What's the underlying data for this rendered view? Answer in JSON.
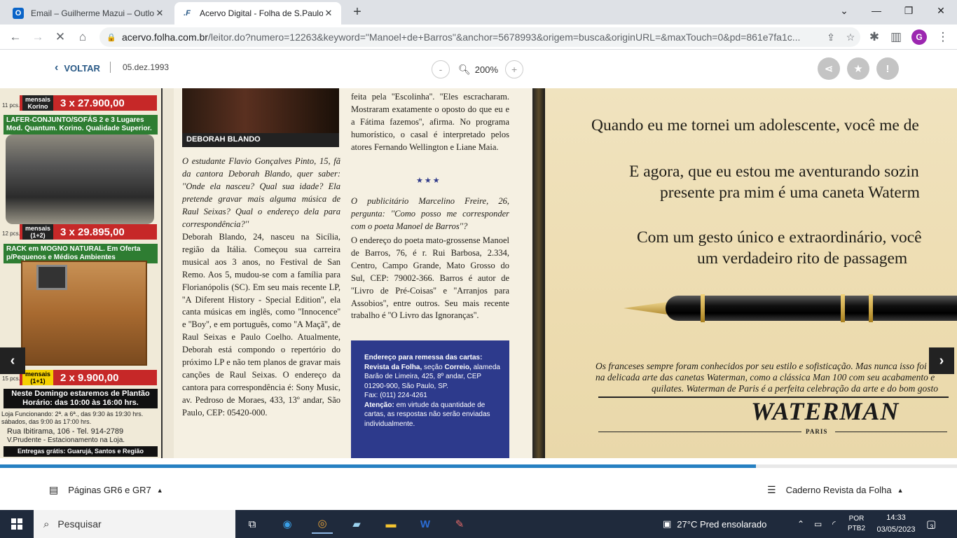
{
  "browser": {
    "tabs": [
      {
        "title": "Email – Guilherme Mazui – Outlo",
        "icon": "outlook-icon",
        "active": false
      },
      {
        "title": "Acervo Digital - Folha de S.Paulo",
        "icon": "folha-icon",
        "active": true
      }
    ],
    "new_tab": "+",
    "url_host": "acervo.folha.com.br",
    "url_path": "/leitor.do?numero=12263&keyword=\"Manoel+de+Barros\"&anchor=5678993&origem=busca&originURL=&maxTouch=0&pd=861e7fa1c...",
    "profile_initial": "G"
  },
  "viewer_toolbar": {
    "back_label": "VOLTAR",
    "date": "05.dez.1993",
    "zoom_out": "-",
    "zoom_in": "+",
    "zoom_level": "200%"
  },
  "page": {
    "ad": {
      "band1_tag": "mensais Korino",
      "band1_price": "3 x 27.900,00",
      "pcs1": "11 pcs.",
      "green1": "LAFER-CONJUNTO/SOFÁS 2 e 3 Lugares Mod. Quantum. Korino. Qualidade Superior.",
      "band2_tag": "mensais (1+2)",
      "band2_price": "3 x 29.895,00",
      "pcs2": "12 pcs.",
      "green2": "RACK em MOGNO NATURAL. Em Oferta p/Pequenos e Médios Ambientes",
      "band3_tag": "mensais (1+1)",
      "band3_price": "2 x 9.900,00",
      "pcs3": "15 pcs.",
      "black1": "Neste Domingo estaremos de Plantão Horário: das 10:00 às 16:00 hrs.",
      "hours": "Loja Funcionando: 2ª. a 6ª., das 9:30 às 19:30 hrs. sábados, das 9:00 às 17:00 hrs.",
      "address": "Rua Ibitirama, 106 - Tel. 914-2789",
      "parking": "V.Prudente - Estacionamento na Loja.",
      "black2": "Entregas grátis: Guarujá, Santos e Região"
    },
    "photo_caption": "DEBORAH BLANDO",
    "col1_q": "O estudante Flavio Gonçalves Pinto, 15, fã da cantora Deborah Blando, quer saber: ''Onde ela nasceu? Qual sua idade? Ela pretende gravar mais alguma música de Raul Seixas? Qual o endereço dela para correspondência?''",
    "col1_a": "Deborah Blando, 24, nasceu na Sicília, região da Itália. Começou sua carreira musical aos 3 anos, no Festival de San Remo. Aos 5, mudou-se com a família para Florianópolis (SC). Em seu mais recente LP, ''A Diferent History - Special Edition'', ela canta músicas em inglês, como ''Innocence'' e ''Boy'', e em português, como ''A Maçã'', de Raul Seixas e Paulo Coelho. Atualmente, Deborah está compondo o repertório do próximo LP e não tem planos de gravar mais canções de Raul Seixas. O endereço da cantora para correspondência é: Sony Music, av. Pedroso de Moraes, 433, 13º andar, São Paulo, CEP: 05420-000.",
    "col2_top": "feita pela ''Escolinha''. ''Eles escracharam. Mostraram exatamente o oposto do que eu e a Fátima fazemos'', afirma. No programa humorístico, o casal é interpretado pelos atores Fernando Wellington e Liane Maia.",
    "stars": "★★★",
    "col2_q": "O publicitário Marcelino Freire, 26, pergunta: ''Como posso me corresponder com o poeta Manoel de Barros''?",
    "col2_a": "O endereço do poeta mato-grossense Manoel de Barros, 76, é r. Rui Barbosa, 2.334, Centro, Campo Grande, Mato Grosso do Sul, CEP: 79002-366. Barros é autor de ''Livro de Pré-Coisas'' e ''Arranjos para Assobios'', entre outros. Seu mais recente trabalho é ''O Livro das Ignoranças''.",
    "box_title": "Endereço para remessa das cartas: Revista da Folha,",
    "box_l1": "seção",
    "box_l2": "Correio,",
    "box_l3": "alameda Barão de Limeira, 425, 8º andar,",
    "box_l4": "CEP 01290-900, São Paulo, SP.",
    "box_l5": "Fax: (011) 224-4261",
    "box_l6": "Atenção:",
    "box_l7": "em virtude da quantidade de cartas, as respostas não serão enviadas individualmente.",
    "pen_ad": {
      "l1": "Quando eu me tornei um adolescente, você me de",
      "l2": "E agora, que eu estou me aventurando sozin",
      "l3": "presente pra mim é uma caneta Waterm",
      "l4": "Com um gesto único e extraordinário, você",
      "l5": "um verdadeiro rito de passagem",
      "i1": "Os franceses sempre foram conhecidos por seu estilo e sofisticação. Mas nunca isso foi t",
      "i2": "na delicada arte das canetas Waterman, como a clássica Man 100 com seu acabamento e",
      "i3": "quilates. Waterman de Paris é a perfeita celebração da arte e do bom gosto",
      "logo": "WATERMAN",
      "paris": "PARIS"
    }
  },
  "progress": 0.79,
  "bottombar": {
    "left_label": "Páginas GR6 e GR7",
    "right_label": "Caderno Revista da Folha"
  },
  "taskbar": {
    "search_placeholder": "Pesquisar",
    "weather": "27°C  Pred ensolarado",
    "lang1": "POR",
    "lang2": "PTB2",
    "time": "14:33",
    "date": "03/05/2023",
    "notif_count": "3"
  }
}
